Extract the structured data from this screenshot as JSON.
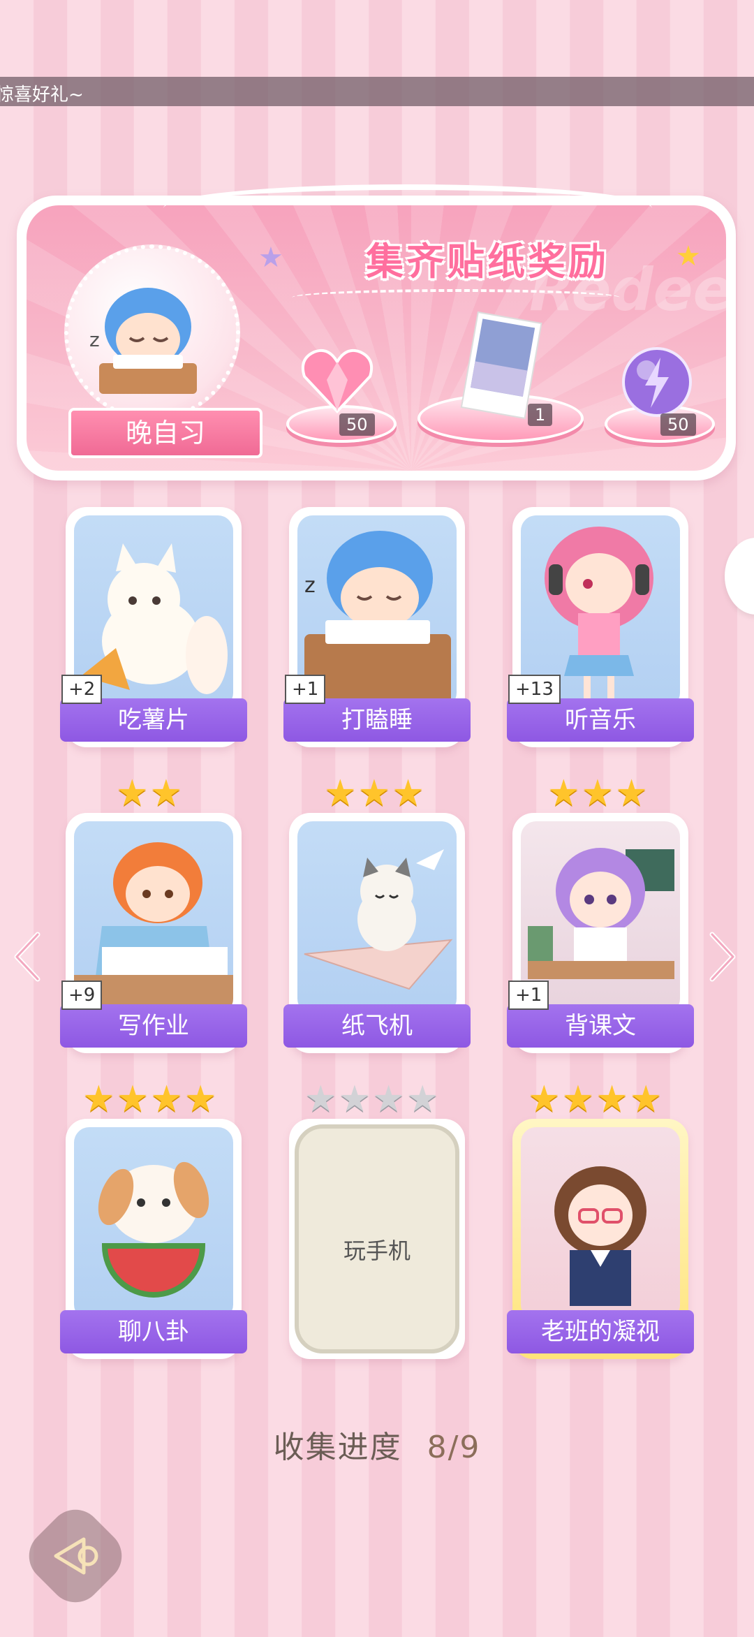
{
  "marquee": {
    "text": "惊喜好礼~"
  },
  "reward_panel": {
    "title": "集齐贴纸奖励",
    "watermark": "Redeem",
    "avatar_label": "晚自习",
    "rewards": [
      {
        "icon": "heart-gem-icon",
        "count": "50"
      },
      {
        "icon": "photo-card-icon",
        "count": "1"
      },
      {
        "icon": "lightning-orb-icon",
        "count": "50"
      }
    ]
  },
  "cards": [
    {
      "name": "吃薯片",
      "plus": "+2",
      "stars": 0,
      "state": "collected"
    },
    {
      "name": "打瞌睡",
      "plus": "+1",
      "stars": 0,
      "state": "collected"
    },
    {
      "name": "听音乐",
      "plus": "+13",
      "stars": 0,
      "state": "collected"
    },
    {
      "name": "写作业",
      "plus": "+9",
      "stars": 2,
      "state": "collected"
    },
    {
      "name": "纸飞机",
      "plus": "",
      "stars": 3,
      "state": "collected"
    },
    {
      "name": "背课文",
      "plus": "+1",
      "stars": 3,
      "state": "collected"
    },
    {
      "name": "聊八卦",
      "plus": "",
      "stars": 4,
      "state": "collected"
    },
    {
      "name": "玩手机",
      "plus": "",
      "stars": 4,
      "state": "locked"
    },
    {
      "name": "老班的凝视",
      "plus": "",
      "stars": 4,
      "state": "collected-gold"
    }
  ],
  "progress": {
    "label": "收集进度",
    "value": "8/9"
  },
  "colors": {
    "accent_pink": "#ff6f9e",
    "label_purple": "#9560e6",
    "star_gold": "#ffc42b"
  }
}
